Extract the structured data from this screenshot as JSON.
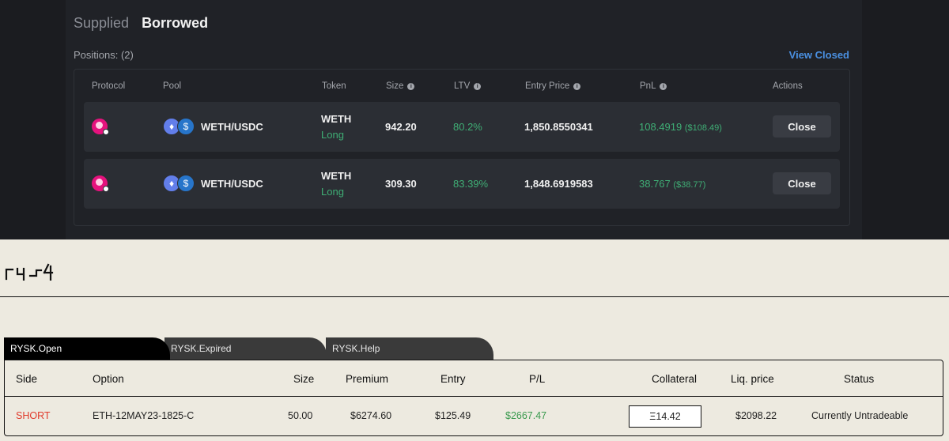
{
  "top": {
    "tabs": [
      {
        "label": "Supplied",
        "active": false
      },
      {
        "label": "Borrowed",
        "active": true
      }
    ],
    "positions_label": "Positions: (2)",
    "view_closed": "View Closed",
    "columns": {
      "protocol": "Protocol",
      "pool": "Pool",
      "token": "Token",
      "size": "Size",
      "ltv": "LTV",
      "entry_price": "Entry Price",
      "pnl": "PnL",
      "actions": "Actions"
    },
    "rows": [
      {
        "protocol_icon": "protocol-logo-icon",
        "pool": "WETH/USDC",
        "token": "WETH",
        "side": "Long",
        "size": "942.20",
        "ltv": "80.2%",
        "entry_price": "1,850.8550341",
        "pnl": "108.4919",
        "pnl_usd": "($108.49)",
        "action": "Close"
      },
      {
        "protocol_icon": "protocol-logo-icon",
        "pool": "WETH/USDC",
        "token": "WETH",
        "side": "Long",
        "size": "309.30",
        "ltv": "83.39%",
        "entry_price": "1,848.6919583",
        "pnl": "38.767",
        "pnl_usd": "($38.77)",
        "action": "Close"
      }
    ],
    "colors": {
      "accent_green": "#3fae75",
      "link_blue": "#4a90e2",
      "protocol_pink": "#e5127d"
    }
  },
  "bottom": {
    "tabs": [
      "RYSK.Open",
      "RYSK.Expired",
      "RYSK.Help"
    ],
    "columns": [
      "Side",
      "Option",
      "Size",
      "Premium",
      "Entry",
      "P/L",
      "Collateral",
      "Liq. price",
      "Status"
    ],
    "row": {
      "side": "SHORT",
      "option": "ETH-12MAY23-1825-C",
      "size": "50.00",
      "premium": "$6274.60",
      "entry": "$125.49",
      "pl": "$2667.47",
      "collateral": "Ξ14.42",
      "liq_price": "$2098.22",
      "status": "Currently Untradeable"
    },
    "colors": {
      "short_red": "#e03a2b",
      "pl_green": "#3a9a4e",
      "background": "#edeae0"
    }
  }
}
